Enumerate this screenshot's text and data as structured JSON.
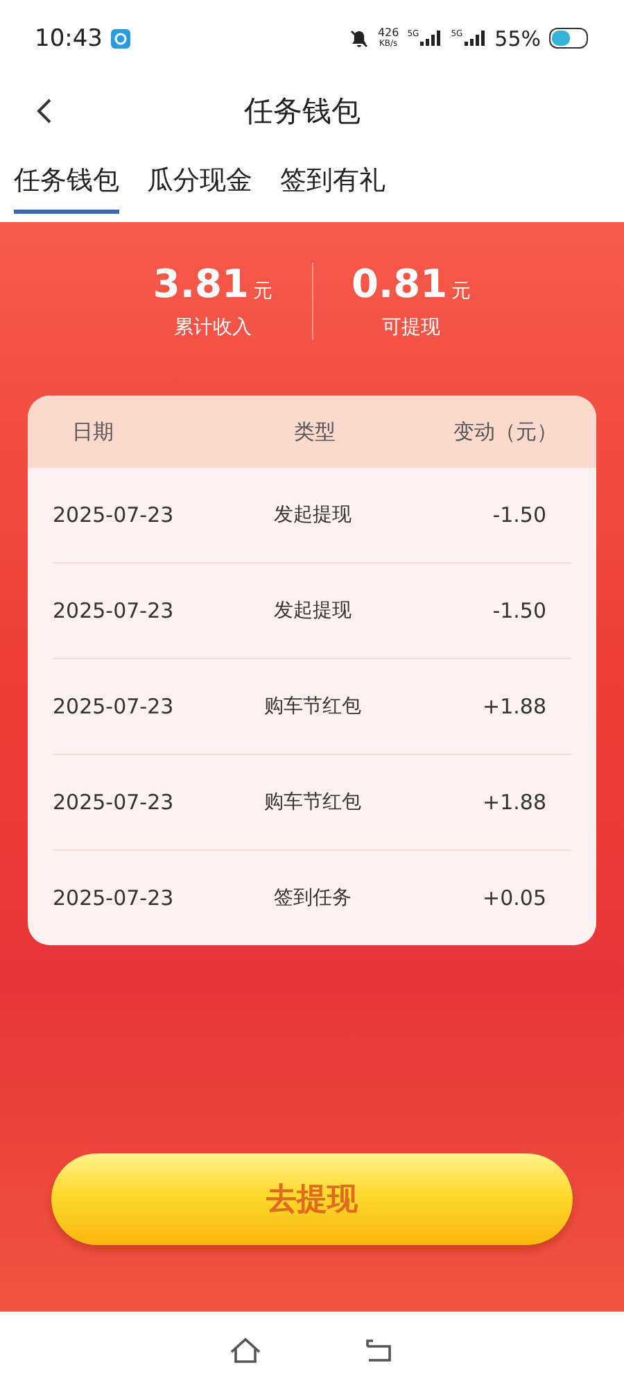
{
  "status_bar": {
    "time": "10:43",
    "speed": "426",
    "speed_unit": "KB/s",
    "signal_1": "5G",
    "signal_2": "5G",
    "battery": "55%"
  },
  "header": {
    "title": "任务钱包"
  },
  "tabs": [
    {
      "label": "任务钱包",
      "selected": true
    },
    {
      "label": "瓜分现金",
      "selected": false
    },
    {
      "label": "签到有礼",
      "selected": false
    }
  ],
  "summary": [
    {
      "value": "3.81",
      "unit": "元",
      "label": "累计收入"
    },
    {
      "value": "0.81",
      "unit": "元",
      "label": "可提现"
    }
  ],
  "table": {
    "columns": [
      "日期",
      "类型",
      "变动（元）"
    ],
    "rows": [
      [
        "2025-07-23",
        "发起提现",
        "-1.50"
      ],
      [
        "2025-07-23",
        "发起提现",
        "-1.50"
      ],
      [
        "2025-07-23",
        "购车节红包",
        "+1.88"
      ],
      [
        "2025-07-23",
        "购车节红包",
        "+1.88"
      ],
      [
        "2025-07-23",
        "签到任务",
        "+0.05"
      ]
    ]
  },
  "withdraw_button": {
    "label": "去提现"
  }
}
